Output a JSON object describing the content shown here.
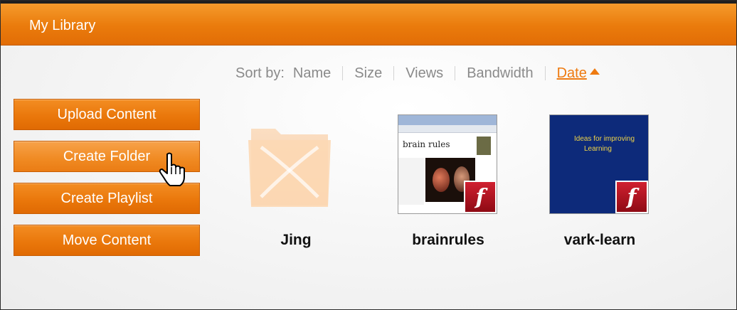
{
  "header": {
    "title": "My Library"
  },
  "sort": {
    "label": "Sort by:",
    "options": [
      "Name",
      "Size",
      "Views",
      "Bandwidth"
    ],
    "active": "Date",
    "direction_icon": "triangle-up-icon"
  },
  "actions": [
    {
      "label": "Upload Content"
    },
    {
      "label": "Create Folder"
    },
    {
      "label": "Create Playlist"
    },
    {
      "label": "Move Content"
    }
  ],
  "items": [
    {
      "name": "Jing",
      "kind": "folder"
    },
    {
      "name": "brainrules",
      "kind": "flash",
      "thumb_title": "brain rules"
    },
    {
      "name": "vark-learn",
      "kind": "flash",
      "thumb_lines": [
        "Ideas for improving",
        "Learning"
      ]
    }
  ],
  "colors": {
    "accent": "#ea7b0c",
    "sort_active": "#ee7a10"
  }
}
